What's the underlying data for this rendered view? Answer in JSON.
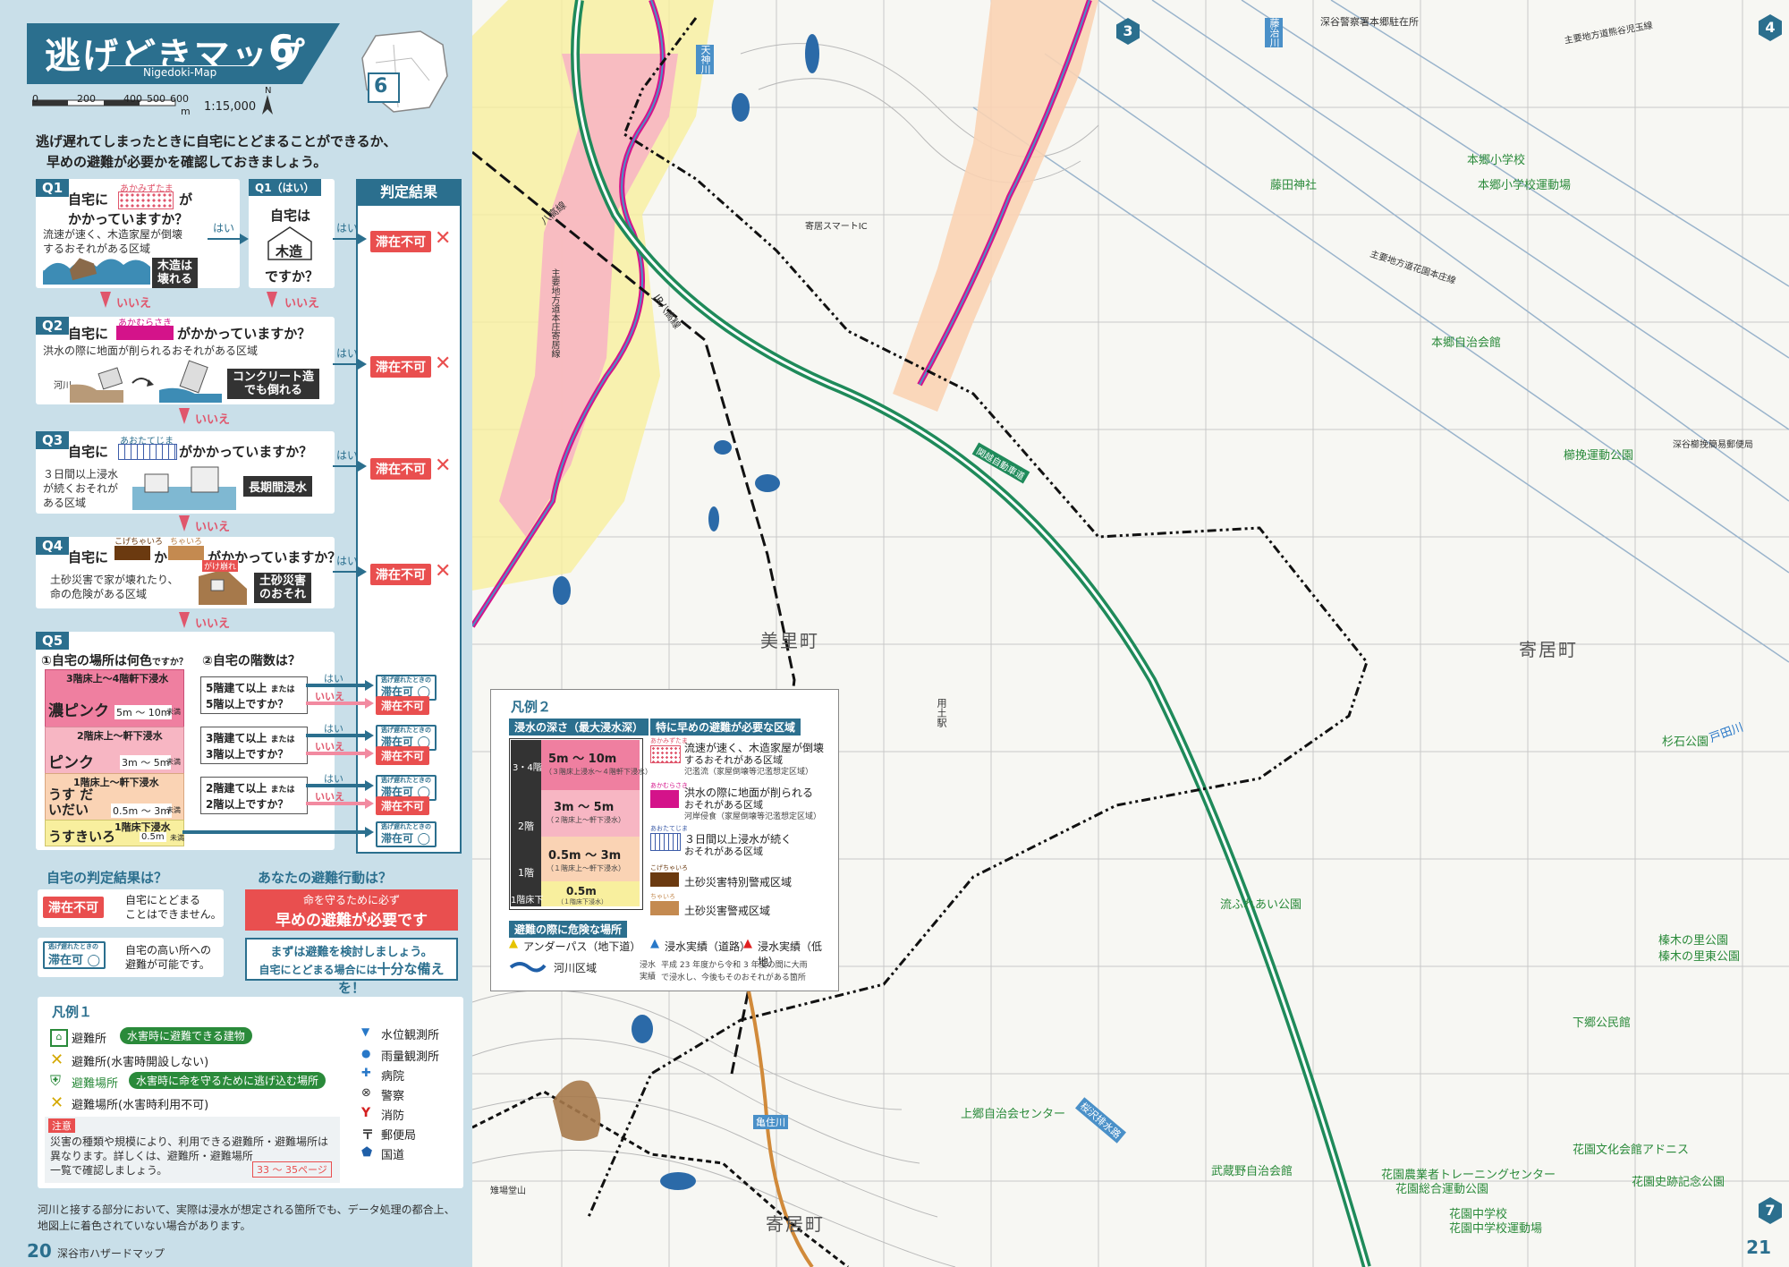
{
  "header": {
    "title": "逃げどきマップ",
    "map_number": "6",
    "subtitle": "Nigedoki-Map",
    "scale_ticks": [
      "0",
      "200",
      "400",
      "500",
      "600"
    ],
    "scale_unit": "m",
    "scale_ratio": "1:15,000",
    "north": "N",
    "index_number": "6"
  },
  "intro": {
    "line1": "逃げ遅れてしまったときに自宅にとどまることができるか、",
    "line2": "早めの避難が必要かを確認しておきましょう。"
  },
  "result_header": "判定結果",
  "q1": {
    "tag": "Q1",
    "pre": "自宅に",
    "zone_ruby": "あかみずたま",
    "post": "が",
    "line2": "かかっていますか？",
    "desc1": "流速が速く、木造家屋が倒壊",
    "desc2": "するおそれがある区域",
    "badge1": "木造は",
    "badge2": "壊れる",
    "yes": "はい",
    "no": "いいえ"
  },
  "q1b": {
    "tag": "Q1（はい）",
    "line1": "自宅は",
    "wood": "木造",
    "line2": "ですか？",
    "yes": "はい",
    "no": "いいえ"
  },
  "q2": {
    "tag": "Q2",
    "pre": "自宅に",
    "zone_ruby": "あかむらさき",
    "post": "がかかっていますか？",
    "desc": "洪水の際に地面が削られるおそれがある区域",
    "river": "河川",
    "badge1": "コンクリート造",
    "badge2": "でも倒れる",
    "yes": "はい",
    "no": "いいえ"
  },
  "q3": {
    "tag": "Q3",
    "pre": "自宅に",
    "zone_ruby": "あおたてじま",
    "post": "がかかっていますか？",
    "desc1": "３日間以上浸水",
    "desc2": "が続くおそれが",
    "desc3": "ある区域",
    "badge": "長期間浸水",
    "yes": "はい",
    "no": "いいえ"
  },
  "q4": {
    "tag": "Q4",
    "pre": "自宅に",
    "ruby1": "こげちゃいろ",
    "mid": "か",
    "ruby2": "ちゃいろ",
    "post": "がかかっていますか？",
    "desc1": "土砂災害で家が壊れたり、",
    "desc2": "命の危険がある区域",
    "hazard": "がけ崩れ",
    "badge1": "土砂災害",
    "badge2": "のおそれ",
    "yes": "はい",
    "no": "いいえ"
  },
  "result_unsafe": "滞在不可",
  "result_safe_top": "逃げ遅れたときの",
  "result_safe": "滞在可",
  "q5": {
    "tag": "Q5",
    "sub1": "①自宅の場所は何色",
    "sub1b": "ですか？",
    "sub2": "②自宅の階数は？",
    "rows": [
      {
        "floor": "3階床上～4階軒下浸水",
        "name": "濃ピンク",
        "depth": "5m ～ 10m",
        "unit": "未満",
        "color": "#ef7fa0",
        "q_a": "5階建て以上",
        "q_a2": "または",
        "q_b": "5階以上ですか？"
      },
      {
        "floor": "2階床上～軒下浸水",
        "name": "ピンク",
        "depth": "3m ～ 5m",
        "unit": "未満",
        "color": "#f7b6c3",
        "q_a": "3階建て以上",
        "q_a2": "または",
        "q_b": "3階以上ですか？"
      },
      {
        "floor": "1階床上～軒下浸水",
        "name": "うす だいだい",
        "depth": "0.5m ～ 3m",
        "unit": "未満",
        "color": "#fad3b4",
        "q_a": "2階建て以上",
        "q_a2": "または",
        "q_b": "2階以上ですか？"
      },
      {
        "floor": "1階床下浸水",
        "name": "うすきいろ",
        "depth": "0.5m",
        "unit": "未満",
        "color": "#f8ef9e",
        "q_a": "",
        "q_a2": "",
        "q_b": ""
      }
    ],
    "yes": "はい",
    "no": "いいえ"
  },
  "judge": {
    "head1": "自宅の判定結果は？",
    "head2": "あなたの避難行動は？",
    "unsafe_desc1": "自宅にとどまる",
    "unsafe_desc2": "ことはできません。",
    "action_red1": "命を守るために必ず",
    "action_red2": "早めの避難が必要です",
    "safe_desc1": "自宅の高い所への",
    "safe_desc2": "避難が可能です。",
    "action_blue1": "まずは避難を検討しましょう。",
    "action_blue2a": "自宅にとどまる場合には",
    "action_blue2b": "十分な備えを！"
  },
  "legend1": {
    "title": "凡例１",
    "items": [
      {
        "label": "避難所",
        "tag": "水害時に避難できる建物",
        "icon": "shelter-icon"
      },
      {
        "label": "避難所(水害時開設しない)",
        "tag": "",
        "icon": "shelter-closed-icon"
      },
      {
        "label": "避難場所",
        "tag": "水害時に命を守るために逃げ込む場所",
        "icon": "evac-site-icon"
      },
      {
        "label": "避難場所(水害時利用不可)",
        "tag": "",
        "icon": "evac-site-closed-icon"
      }
    ],
    "symbols": [
      "水位観測所",
      "雨量観測所",
      "病院",
      "警察",
      "消防",
      "郵便局",
      "国道"
    ],
    "note_head": "注意",
    "note1": "災害の種類や規模により、利用できる避難所・避難場所は",
    "note2": "異なります。詳しくは、避難所・避難場所",
    "note3": "一覧で確認しましょう。",
    "note_pages": "33 ～ 35ページ"
  },
  "footnote1": "河川と接する部分において、実際は浸水が想定される箇所でも、データ処理の都合上、",
  "footnote2": "地図上に着色されていない場合があります。",
  "page_left": {
    "number": "20",
    "label": "深谷市ハザードマップ"
  },
  "page_right": {
    "number": "21"
  },
  "legend2": {
    "title": "凡例２",
    "head_depth": "浸水の深さ（最大浸水深）",
    "head_zone": "特に早めの避難が必要な区域",
    "depths": [
      {
        "floors": "3・4階",
        "range": "5m ～ 10m",
        "unit": "未満",
        "note": "（３階床上浸水～４階軒下浸水）"
      },
      {
        "floors": "2階",
        "range": "3m ～ 5m",
        "unit": "未満",
        "note": "（２階床上～軒下浸水）"
      },
      {
        "floors": "1階",
        "range": "0.5m ～ 3m",
        "unit": "未満",
        "note": "（１階床上～軒下浸水）"
      },
      {
        "floors": "1階床下",
        "range": "0.5m",
        "unit": "未満",
        "note": "（１階床下浸水）"
      }
    ],
    "zones": [
      {
        "ruby": "あかみずたま",
        "t1": "流速が速く、木造家屋が倒壊",
        "t2": "するおそれがある区域",
        "t3": "氾濫流（家屋倒壊等氾濫想定区域）"
      },
      {
        "ruby": "あかむらさき",
        "t1": "洪水の際に地面が削られる",
        "t2": "おそれがある区域",
        "t3": "河岸侵食（家屋倒壊等氾濫想定区域）"
      },
      {
        "ruby": "あおたてじま",
        "t1": "３日間以上浸水が続く",
        "t2": "おそれがある区域",
        "t3": ""
      },
      {
        "ruby": "こげちゃいろ",
        "t1": "土砂災害特別警戒区域",
        "t2": "",
        "t3": ""
      },
      {
        "ruby": "ちゃいろ",
        "t1": "土砂災害警戒区域",
        "t2": "",
        "t3": ""
      }
    ],
    "danger_head": "避難の際に危険な場所",
    "underpass": "アンダーパス（地下道）",
    "flood_road": "浸水実績（道路）",
    "flood_low": "浸水実績（低地）",
    "river": "河川区域",
    "record_head": "浸水実績",
    "record1": "平成 23 年度から令和 3 年度の間に大雨",
    "record2": "で浸水し、今後もそのおそれがある箇所"
  },
  "map_labels": [
    {
      "text": "深谷警察署本郷駐在所"
    },
    {
      "text": "主要地方道熊谷児玉線"
    },
    {
      "text": "本郷小学校"
    },
    {
      "text": "藤田神社"
    },
    {
      "text": "本郷小学校運動場"
    },
    {
      "text": "主要地方道花園本庄線"
    },
    {
      "text": "本郷自治会館"
    },
    {
      "text": "深谷櫛挽簡易郵便局"
    },
    {
      "text": "櫛挽運動公園"
    },
    {
      "text": "杉石公園"
    },
    {
      "text": "戸田川"
    },
    {
      "text": "流ふれあい公園"
    },
    {
      "text": "榛木の里公園"
    },
    {
      "text": "榛木の里東公園"
    },
    {
      "text": "下郷公民館"
    },
    {
      "text": "上郷自治会センター"
    },
    {
      "text": "花園文化会館アドニス"
    },
    {
      "text": "武蔵野自治会館"
    },
    {
      "text": "花園農業者トレーニングセンター"
    },
    {
      "text": "花園総合運動公園"
    },
    {
      "text": "花園史跡記念公園"
    },
    {
      "text": "花園中学校"
    },
    {
      "text": "花園中学校運動場"
    },
    {
      "text": "関越自動車道"
    },
    {
      "text": "天神川"
    },
    {
      "text": "藤治川"
    },
    {
      "text": "亀住川"
    },
    {
      "text": "桜沢排水路"
    },
    {
      "text": "八高線"
    },
    {
      "text": "JR八高線"
    },
    {
      "text": "主要地方道本庄寄居線"
    },
    {
      "text": "寄居スマートIC"
    },
    {
      "text": "用土駅"
    },
    {
      "text": "雉場堂山"
    }
  ],
  "towns": [
    "美里町",
    "寄居町",
    "寄居町"
  ],
  "neighbor_pages": [
    "3",
    "4",
    "7"
  ],
  "colors": {
    "accent": "#2b6f8e",
    "danger": "#e94f4f",
    "pink_dark": "#ef7fa0",
    "magenta": "#d4138a",
    "expressway": "#1f8a5a"
  }
}
